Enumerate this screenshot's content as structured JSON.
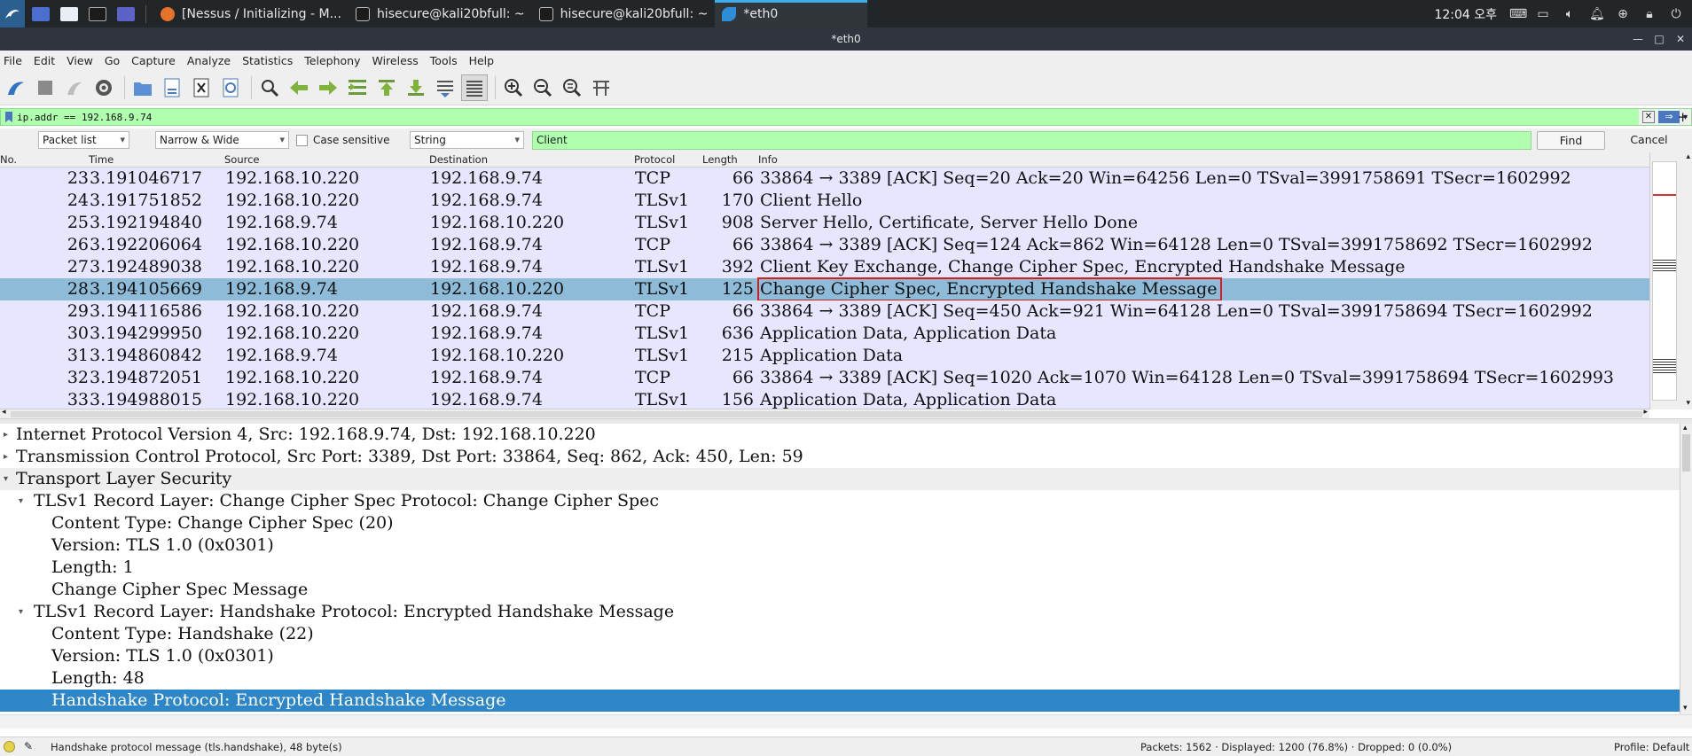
{
  "taskbar": {
    "tasks": [
      {
        "label": "[Nessus / Initializing - M...",
        "active": false
      },
      {
        "label": "hisecure@kali20bfull: ~",
        "active": false
      },
      {
        "label": "hisecure@kali20bfull: ~",
        "active": false
      },
      {
        "label": "*eth0",
        "active": true
      }
    ],
    "clock": "12:04 오후"
  },
  "window": {
    "title": "*eth0"
  },
  "menu": [
    "File",
    "Edit",
    "View",
    "Go",
    "Capture",
    "Analyze",
    "Statistics",
    "Telephony",
    "Wireless",
    "Tools",
    "Help"
  ],
  "filter": {
    "value": "ip.addr == 192.168.9.74"
  },
  "find": {
    "search_in": "Packet list",
    "char_width": "Narrow & Wide",
    "case_sensitive_label": "Case sensitive",
    "type": "String",
    "query": "Client",
    "find_label": "Find",
    "cancel_label": "Cancel"
  },
  "packet_list": {
    "columns": [
      "No.",
      "Time",
      "Source",
      "Destination",
      "Protocol",
      "Length",
      "Info"
    ],
    "rows": [
      {
        "no": "23",
        "time": "3.191046717",
        "src": "192.168.10.220",
        "dst": "192.168.9.74",
        "proto": "TCP",
        "len": "66",
        "info": "33864 → 3389 [ACK] Seq=20 Ack=20 Win=64256 Len=0 TSval=3991758691 TSecr=1602992"
      },
      {
        "no": "24",
        "time": "3.191751852",
        "src": "192.168.10.220",
        "dst": "192.168.9.74",
        "proto": "TLSv1",
        "len": "170",
        "info": "Client Hello"
      },
      {
        "no": "25",
        "time": "3.192194840",
        "src": "192.168.9.74",
        "dst": "192.168.10.220",
        "proto": "TLSv1",
        "len": "908",
        "info": "Server Hello, Certificate, Server Hello Done"
      },
      {
        "no": "26",
        "time": "3.192206064",
        "src": "192.168.10.220",
        "dst": "192.168.9.74",
        "proto": "TCP",
        "len": "66",
        "info": "33864 → 3389 [ACK] Seq=124 Ack=862 Win=64128 Len=0 TSval=3991758692 TSecr=1602992"
      },
      {
        "no": "27",
        "time": "3.192489038",
        "src": "192.168.10.220",
        "dst": "192.168.9.74",
        "proto": "TLSv1",
        "len": "392",
        "info": "Client Key Exchange, Change Cipher Spec, Encrypted Handshake Message"
      },
      {
        "no": "28",
        "time": "3.194105669",
        "src": "192.168.9.74",
        "dst": "192.168.10.220",
        "proto": "TLSv1",
        "len": "125",
        "info": "Change Cipher Spec, Encrypted Handshake Message",
        "selected": true
      },
      {
        "no": "29",
        "time": "3.194116586",
        "src": "192.168.10.220",
        "dst": "192.168.9.74",
        "proto": "TCP",
        "len": "66",
        "info": "33864 → 3389 [ACK] Seq=450 Ack=921 Win=64128 Len=0 TSval=3991758694 TSecr=1602992"
      },
      {
        "no": "30",
        "time": "3.194299950",
        "src": "192.168.10.220",
        "dst": "192.168.9.74",
        "proto": "TLSv1",
        "len": "636",
        "info": "Application Data, Application Data"
      },
      {
        "no": "31",
        "time": "3.194860842",
        "src": "192.168.9.74",
        "dst": "192.168.10.220",
        "proto": "TLSv1",
        "len": "215",
        "info": "Application Data"
      },
      {
        "no": "32",
        "time": "3.194872051",
        "src": "192.168.10.220",
        "dst": "192.168.9.74",
        "proto": "TCP",
        "len": "66",
        "info": "33864 → 3389 [ACK] Seq=1020 Ack=1070 Win=64128 Len=0 TSval=3991758694 TSecr=1602993"
      },
      {
        "no": "33",
        "time": "3.194988015",
        "src": "192.168.10.220",
        "dst": "192.168.9.74",
        "proto": "TLSv1",
        "len": "156",
        "info": "Application Data, Application Data"
      }
    ]
  },
  "details": [
    {
      "text": "Internet Protocol Version 4, Src: 192.168.9.74, Dst: 192.168.10.220",
      "level": 0,
      "expanded": false
    },
    {
      "text": "Transmission Control Protocol, Src Port: 3389, Dst Port: 33864, Seq: 862, Ack: 450, Len: 59",
      "level": 0,
      "expanded": false
    },
    {
      "text": "Transport Layer Security",
      "level": 0,
      "expanded": true,
      "header": true
    },
    {
      "text": "TLSv1 Record Layer: Change Cipher Spec Protocol: Change Cipher Spec",
      "level": 1,
      "expanded": true
    },
    {
      "text": "Content Type: Change Cipher Spec (20)",
      "level": 2
    },
    {
      "text": "Version: TLS 1.0 (0x0301)",
      "level": 2
    },
    {
      "text": "Length: 1",
      "level": 2
    },
    {
      "text": "Change Cipher Spec Message",
      "level": 2
    },
    {
      "text": "TLSv1 Record Layer: Handshake Protocol: Encrypted Handshake Message",
      "level": 1,
      "expanded": true
    },
    {
      "text": "Content Type: Handshake (22)",
      "level": 2
    },
    {
      "text": "Version: TLS 1.0 (0x0301)",
      "level": 2
    },
    {
      "text": "Length: 48",
      "level": 2
    },
    {
      "text": "Handshake Protocol: Encrypted Handshake Message",
      "level": 2,
      "selected": true
    }
  ],
  "status": {
    "field": "Handshake protocol message (tls.handshake), 48 byte(s)",
    "packets": "Packets: 1562 · Displayed: 1200 (76.8%) · Dropped: 0 (0.0%)",
    "profile": "Profile: Default"
  },
  "colors": {
    "filter_valid": "#afffaf",
    "row_tls": "#e7e6ff",
    "row_selected": "#8ebbd8",
    "detail_selected": "#2c86c8",
    "highlight_box": "#d81c1c"
  }
}
